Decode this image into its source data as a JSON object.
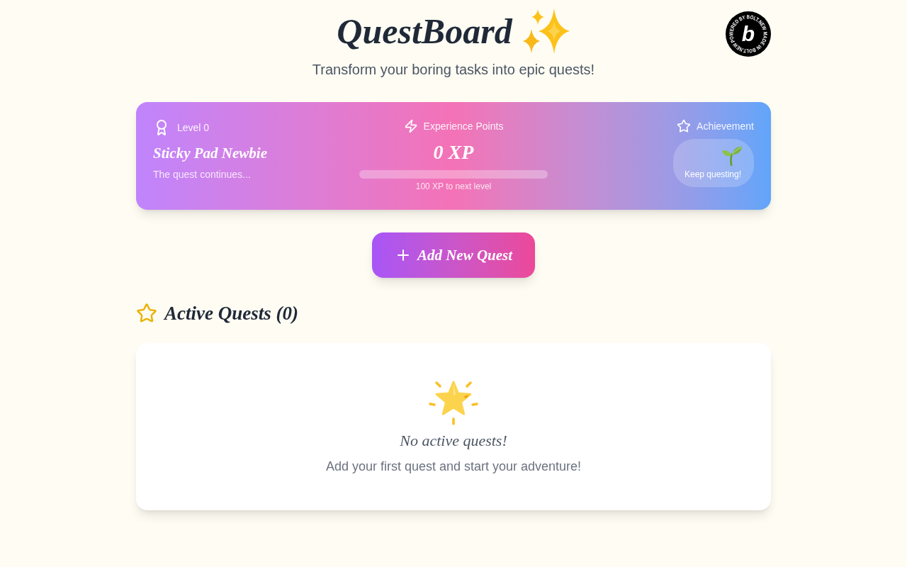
{
  "header": {
    "title": "QuestBoard",
    "subtitle": "Transform your boring tasks into epic quests!"
  },
  "badge": {
    "ring_text": "POWERED BY BOLT.NEW MADE IN BOLT.NEW",
    "logo_letter": "b"
  },
  "stats": {
    "player": {
      "label": "Level 0",
      "rank": "Sticky Pad Newbie",
      "tagline": "The quest continues..."
    },
    "experience": {
      "label": "Experience Points",
      "value": "0 XP",
      "level": 0,
      "caption": "100 XP to next level"
    },
    "achievement": {
      "label": "Achievement",
      "caption": "Keep questing!"
    }
  },
  "add_button": {
    "label": "Add New Quest"
  },
  "active_quests": {
    "heading": "Active Quests (0)",
    "empty_state": {
      "title": "No active quests!",
      "message": "Add your first quest and start your adventure!"
    }
  }
}
